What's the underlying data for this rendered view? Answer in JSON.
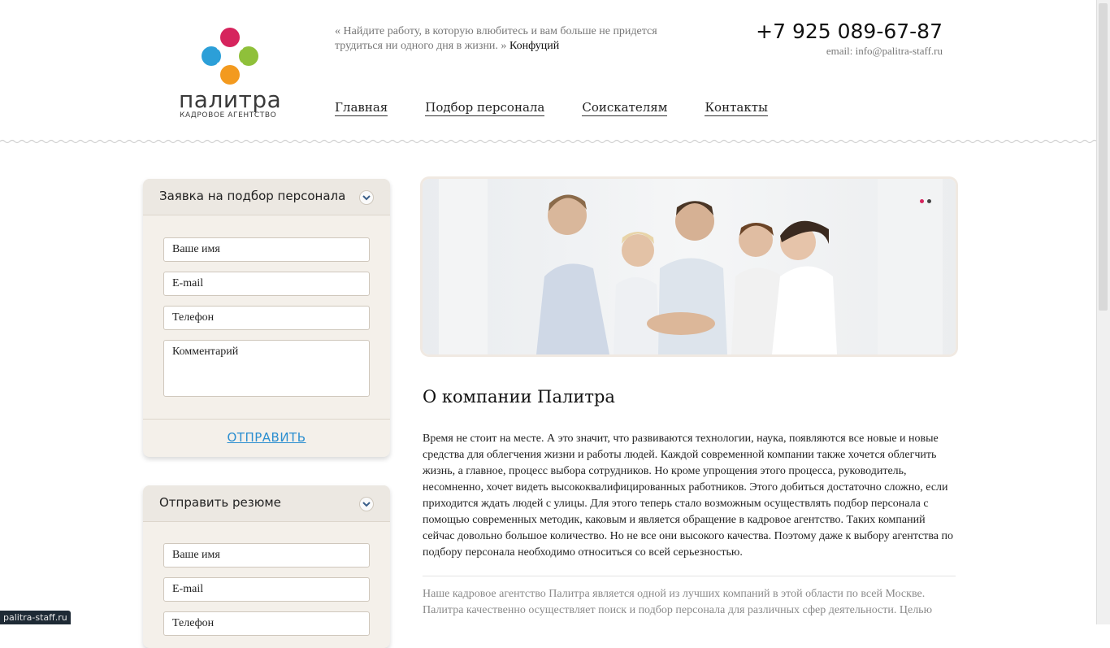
{
  "header": {
    "logo_word": "палитра",
    "logo_sub": "КАДРОВОЕ АГЕНТСТВО",
    "quote_text": "« Найдите работу, в которую влюбитесь и вам больше не придется трудиться ни одного дня в жизни. »",
    "quote_author": "Конфуций",
    "phone": "+7 925 089-67-87",
    "email": "email: info@palitra-staff.ru",
    "nav": [
      "Главная",
      "Подбор персонала",
      "Соискателям",
      "Контакты"
    ]
  },
  "sidebar": {
    "request_form": {
      "title": "Заявка на подбор персонала",
      "name_placeholder": "Ваше имя",
      "email_placeholder": "E-mail",
      "phone_placeholder": "Телефон",
      "comment_placeholder": "Комментарий",
      "submit": "ОТПРАВИТЬ"
    },
    "resume_form": {
      "title": "Отправить резюме",
      "name_placeholder": "Ваше имя",
      "email_placeholder": "E-mail",
      "phone_placeholder": "Телефон"
    }
  },
  "main": {
    "slider": {
      "dots": 2,
      "active_dot": 0
    },
    "title": "О компании Палитра",
    "paragraph1": "Время не стоит на месте. А это значит, что развиваются технологии, наука, появляются все новые и новые средства для облегчения жизни и работы людей. Каждой современной компании также хочется облегчить жизнь, а главное, процесс выбора сотрудников. Но кроме упрощения этого процесса, руководитель, несомненно, хочет видеть высококвалифицированных работников. Этого добиться достаточно сложно, если приходится ждать людей с улицы. Для этого теперь стало возможным осуществлять подбор персонала с помощью современных методик, каковым и является обращение в кадровое агентство. Таких компаний сейчас довольно большое количество. Но не все они высокого качества. Поэтому даже к выбору агентства по подбору персонала необходимо относиться со всей серьезностью.",
    "paragraph2": "Наше кадровое агентство Палитра является одной из лучших компаний в этой области по всей Москве. Палитра качественно осуществляет поиск и подбор персонала для различных сфер деятельности. Целью"
  },
  "status_url": "palitra-staff.ru",
  "colors": {
    "accent_link": "#2a8ed0",
    "panel_bg": "#f4f0ea",
    "logo_pink": "#d6245d",
    "logo_blue": "#2c9fd8",
    "logo_green": "#8fc03a",
    "logo_orange": "#f39a1f"
  }
}
